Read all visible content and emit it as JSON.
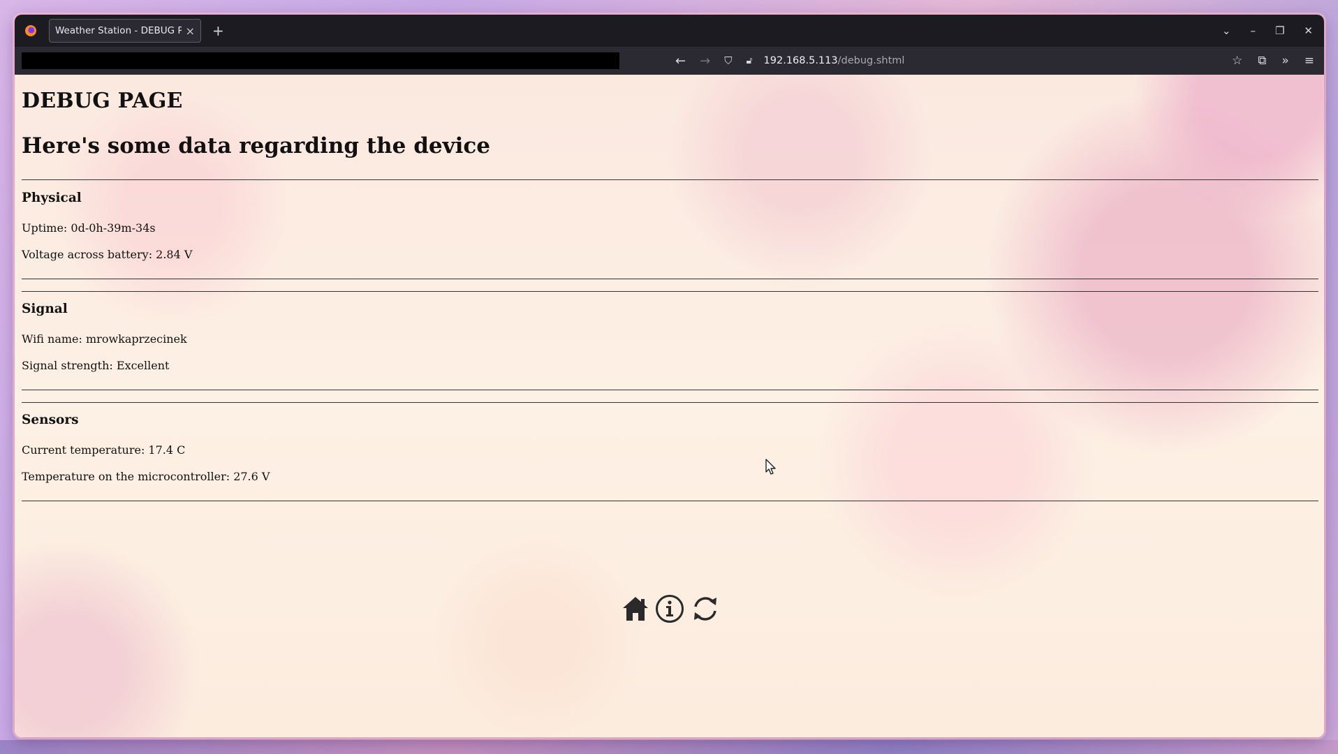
{
  "browser": {
    "tab_title": "Weather Station - DEBUG PAGE",
    "tab_close": "×",
    "new_tab": "+",
    "url_host": "192.168.5.113",
    "url_path": "/debug.shtml"
  },
  "page": {
    "title": "DEBUG PAGE",
    "subtitle": "Here's some data regarding the device"
  },
  "sections": {
    "physical": {
      "heading": "Physical",
      "uptime": "Uptime: 0d-0h-39m-34s",
      "voltage": "Voltage across battery: 2.84 V"
    },
    "signal": {
      "heading": "Signal",
      "wifi": "Wifi name: mrowkaprzecinek",
      "strength": "Signal strength: Excellent"
    },
    "sensors": {
      "heading": "Sensors",
      "temperature": "Current temperature: 17.4 C",
      "mcu_temperature": "Temperature on the microcontroller: 27.6 V"
    }
  },
  "footer_icons": [
    "home-icon",
    "info-icon",
    "refresh-icon"
  ]
}
